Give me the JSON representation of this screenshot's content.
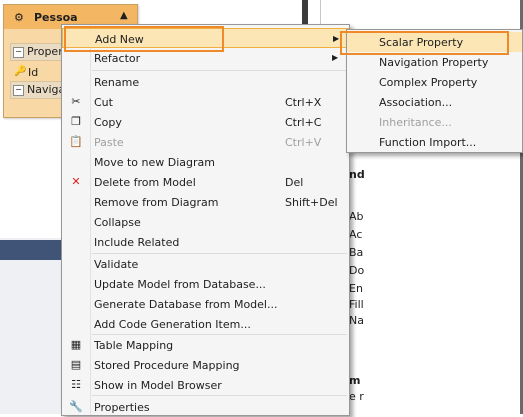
{
  "designer": {
    "entity": {
      "title": "Pessoa",
      "sections": [
        {
          "label": "Propert"
        },
        {
          "label": "Navigat"
        }
      ],
      "properties": [
        {
          "label": "Id"
        }
      ]
    },
    "right_panel_lines": [
      "nd",
      "Ab",
      "Ac",
      "Ba",
      "Do",
      "En",
      "Fill",
      "Na"
    ],
    "right_panel_bottom": [
      "m",
      "e r"
    ]
  },
  "context_menu": {
    "items": [
      {
        "label": "Add New",
        "shortcut": "",
        "has_submenu": true
      },
      {
        "label": "Refactor",
        "shortcut": "",
        "has_submenu": true
      },
      {
        "label": "Rename",
        "shortcut": ""
      },
      {
        "label": "Cut",
        "shortcut": "Ctrl+X"
      },
      {
        "label": "Copy",
        "shortcut": "Ctrl+C"
      },
      {
        "label": "Paste",
        "shortcut": "Ctrl+V",
        "disabled": true
      },
      {
        "label": "Move to new Diagram",
        "shortcut": ""
      },
      {
        "label": "Delete from Model",
        "shortcut": "Del"
      },
      {
        "label": "Remove from Diagram",
        "shortcut": "Shift+Del"
      },
      {
        "label": "Collapse",
        "shortcut": ""
      },
      {
        "label": "Include Related",
        "shortcut": ""
      },
      {
        "label": "Validate",
        "shortcut": ""
      },
      {
        "label": "Update Model from Database...",
        "shortcut": ""
      },
      {
        "label": "Generate Database from Model...",
        "shortcut": ""
      },
      {
        "label": "Add Code Generation Item...",
        "shortcut": ""
      },
      {
        "label": "Table Mapping",
        "shortcut": ""
      },
      {
        "label": "Stored Procedure Mapping",
        "shortcut": ""
      },
      {
        "label": "Show in Model Browser",
        "shortcut": ""
      },
      {
        "label": "Properties",
        "shortcut": ""
      }
    ]
  },
  "submenu": {
    "items": [
      {
        "label": "Scalar Property"
      },
      {
        "label": "Navigation Property"
      },
      {
        "label": "Complex Property"
      },
      {
        "label": "Association..."
      },
      {
        "label": "Inheritance...",
        "disabled": true
      },
      {
        "label": "Function Import..."
      }
    ]
  },
  "icons": {
    "cut": "scissors-icon",
    "copy": "copy-icon",
    "paste": "paste-icon",
    "delete": "delete-x-icon",
    "table_mapping": "table-mapping-icon",
    "stored_procedure": "stored-procedure-icon",
    "model_browser": "model-browser-icon",
    "properties": "wrench-icon"
  },
  "colors": {
    "highlight_outline": "#ef8a2b",
    "entity_header": "#f3b662",
    "menu_bg": "#f5f5f5"
  }
}
